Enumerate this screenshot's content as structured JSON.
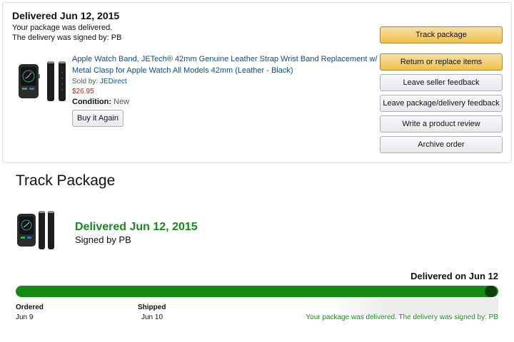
{
  "order": {
    "title": "Delivered Jun 12, 2015",
    "status_line_1": "Your package was delivered.",
    "status_line_2": "The delivery was signed by: PB",
    "product": {
      "title": "Apple Watch Band, JETech® 42mm Genuine Leather Strap Wrist Band Replacement w/ Metal Clasp for Apple Watch All Models 42mm (Leather - Black)",
      "sold_by_label": "Sold by:",
      "seller": "JEDirect",
      "price": "$26.95",
      "condition_label": "Condition:",
      "condition_value": "New",
      "buy_again_label": "Buy it Again"
    },
    "actions": [
      {
        "label": "Track package",
        "style": "primary"
      },
      {
        "label": "Return or replace items",
        "style": "primary"
      },
      {
        "label": "Leave seller feedback",
        "style": "secondary"
      },
      {
        "label": "Leave package/delivery feedback",
        "style": "secondary"
      },
      {
        "label": "Write a product review",
        "style": "secondary"
      },
      {
        "label": "Archive order",
        "style": "secondary"
      }
    ]
  },
  "tracking": {
    "heading": "Track Package",
    "status": "Delivered Jun 12, 2015",
    "signed_by": "Signed by PB",
    "delivered_on": "Delivered on Jun 12",
    "progress": 1.0,
    "milestones": [
      {
        "label": "Ordered",
        "date": "Jun 9"
      },
      {
        "label": "Shipped",
        "date": "Jun 10"
      }
    ],
    "message": "Your package was delivered. The delivery was signed by: PB"
  },
  "colors": {
    "accent_green": "#138a14",
    "link_blue": "#0b4f91",
    "price_red": "#a8281a",
    "primary_button": "#f0c14b"
  },
  "icons": {
    "product_image": "apple-watch-band-image",
    "tracking_image": "apple-watch-band-image"
  }
}
